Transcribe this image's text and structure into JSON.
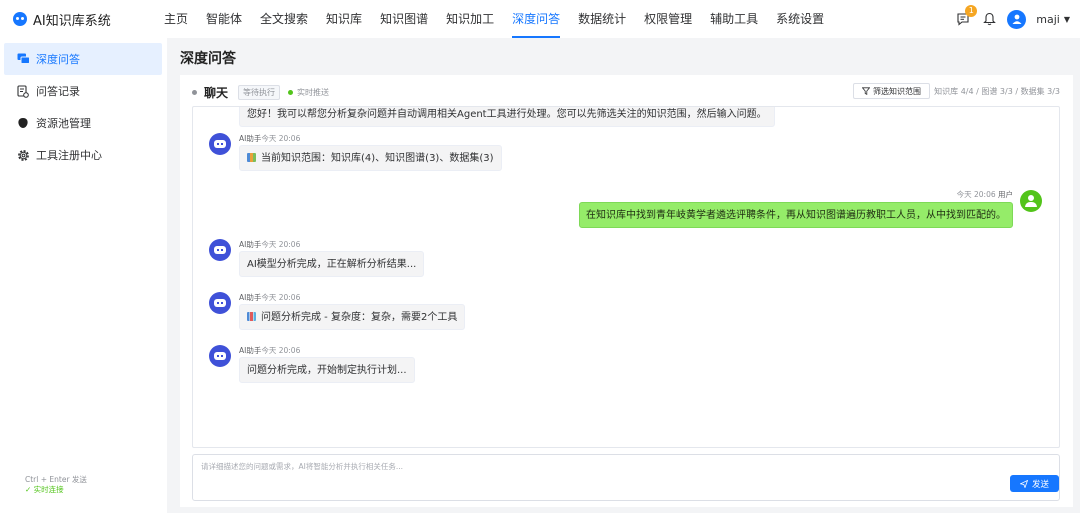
{
  "app": {
    "title": "AI知识库系统"
  },
  "nav": {
    "items": [
      {
        "label": "主页"
      },
      {
        "label": "智能体"
      },
      {
        "label": "全文搜索"
      },
      {
        "label": "知识库"
      },
      {
        "label": "知识图谱"
      },
      {
        "label": "知识加工"
      },
      {
        "label": "深度问答"
      },
      {
        "label": "数据统计"
      },
      {
        "label": "权限管理"
      },
      {
        "label": "辅助工具"
      },
      {
        "label": "系统设置"
      }
    ],
    "active": "深度问答"
  },
  "header": {
    "notification_count": "1",
    "username": "maji"
  },
  "sidebar": {
    "items": [
      {
        "label": "深度问答",
        "icon": "chat-icon"
      },
      {
        "label": "问答记录",
        "icon": "record-icon"
      },
      {
        "label": "资源池管理",
        "icon": "database-icon"
      },
      {
        "label": "工具注册中心",
        "icon": "gear-icon"
      }
    ]
  },
  "page": {
    "title": "深度问答"
  },
  "chat": {
    "title": "聊天",
    "status_tag": "等待执行",
    "push_status": "实时推送",
    "filter_label": "筛选知识范围",
    "scope_stats": "知识库 4/4 / 图谱 3/3 / 数据集 3/3",
    "truncated_text": "您好！我可以帮您分析复杂问题并自动调用相关Agent工具进行处理。您可以先筛选关注的知识范围，然后输入问题。",
    "messages": [
      {
        "role": "assistant",
        "sender": "AI助手",
        "time": "今天 20:06",
        "text": "当前知识范围：知识库(4)、知识图谱(3)、数据集(3)",
        "icon": "books-icon"
      },
      {
        "role": "user",
        "sender": "用户",
        "time": "今天 20:06",
        "text": "在知识库中找到青年岐黄学者遴选评聘条件，再从知识图谱遍历教职工人员，从中找到匹配的。"
      },
      {
        "role": "assistant",
        "sender": "AI助手",
        "time": "今天 20:06",
        "text": "AI模型分析完成，正在解析分析结果..."
      },
      {
        "role": "assistant",
        "sender": "AI助手",
        "time": "今天 20:06",
        "text": "问题分析完成 - 复杂度：复杂，需要2个工具",
        "icon": "bar-chart-icon"
      },
      {
        "role": "assistant",
        "sender": "AI助手",
        "time": "今天 20:06",
        "text": "问题分析完成，开始制定执行计划..."
      }
    ]
  },
  "input": {
    "placeholder": "请详细描述您的问题或需求，AI将智能分析并执行相关任务...",
    "hint": "Ctrl + Enter 发送",
    "connection": "✓ 实时连接",
    "send_label": "发送"
  },
  "colors": {
    "accent": "#1677ff",
    "user_bubble": "#95ec69",
    "bot_avatar": "#3f51d8"
  }
}
